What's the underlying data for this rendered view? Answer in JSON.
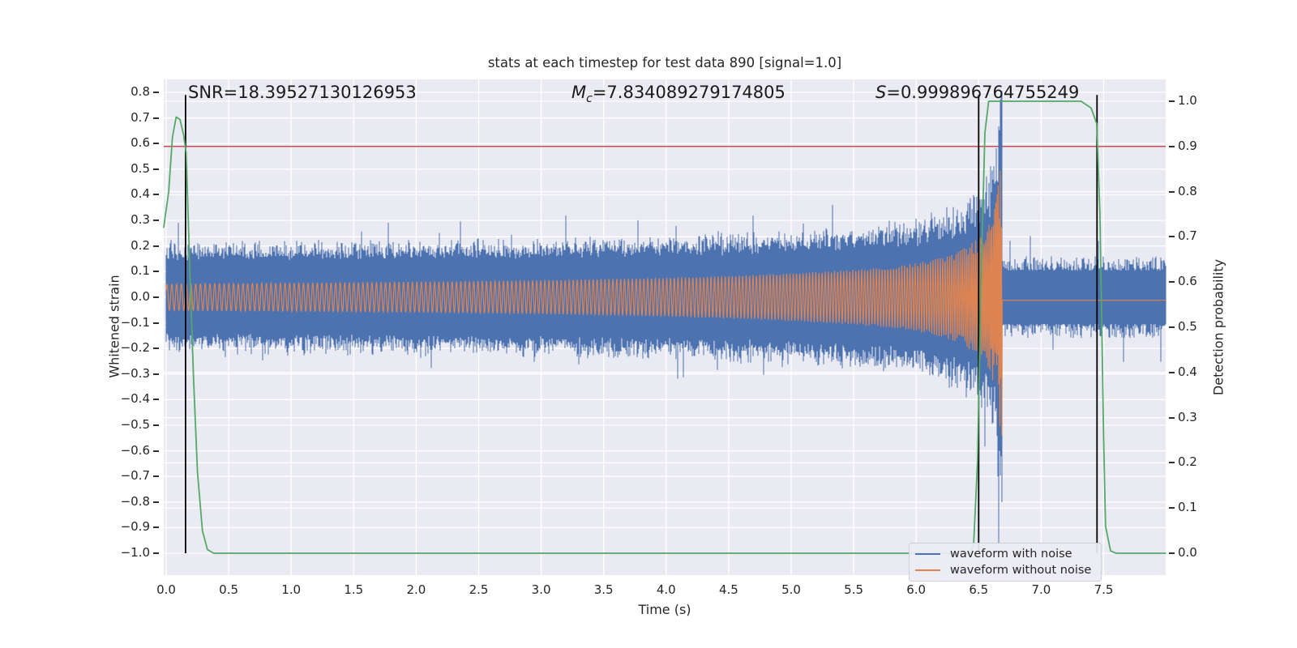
{
  "figure": {
    "kind": "matplotlib-seaborn-darkgrid",
    "background": "#ffffff"
  },
  "chart_data": {
    "type": "line",
    "title": "stats at each timestep for test data 890 [signal=1.0]",
    "xlabel": "Time (s)",
    "ylabel_left": "Whitened strain",
    "ylabel_right": "Detection probability",
    "xlim": [
      -0.02,
      8.0
    ],
    "ylim_left": [
      -1.09,
      0.85
    ],
    "ylim_right": [
      -0.047,
      1.048
    ],
    "grid": true,
    "xticks": {
      "values": [
        0,
        0.5,
        1,
        1.5,
        2,
        2.5,
        3,
        3.5,
        4,
        4.5,
        5,
        5.5,
        6,
        6.5,
        7,
        7.5
      ],
      "labels": [
        "0.0",
        "0.5",
        "1.0",
        "1.5",
        "2.0",
        "2.5",
        "3.0",
        "3.5",
        "4.0",
        "4.5",
        "5.0",
        "5.5",
        "6.0",
        "6.5",
        "7.0",
        "7.5"
      ]
    },
    "yticks_left": {
      "values": [
        0.8,
        0.7,
        0.6,
        0.5,
        0.4,
        0.3,
        0.2,
        0.1,
        0.0,
        -0.1,
        -0.2,
        -0.3,
        -0.4,
        -0.5,
        -0.6,
        -0.7,
        -0.8,
        -0.9,
        -1.0
      ],
      "labels": [
        "0.8",
        "0.7",
        "0.6",
        "0.5",
        "0.4",
        "0.3",
        "0.2",
        "0.1",
        "0.0",
        "−0.1",
        "−0.2",
        "−0.3",
        "−0.4",
        "−0.5",
        "−0.6",
        "−0.7",
        "−0.8",
        "−0.9",
        "−1.0"
      ]
    },
    "yticks_right": {
      "values": [
        1.0,
        0.9,
        0.8,
        0.7,
        0.6,
        0.5,
        0.4,
        0.3,
        0.2,
        0.1,
        0.0
      ],
      "labels": [
        "1.0",
        "0.9",
        "0.8",
        "0.7",
        "0.6",
        "0.5",
        "0.4",
        "0.3",
        "0.2",
        "0.1",
        "0.0"
      ]
    },
    "annotations": {
      "snr": "SNR=18.39527130126953",
      "chirp_mass": {
        "symbol": "M",
        "subscript": "c",
        "value": "=7.834089279174805"
      },
      "s": {
        "symbol": "S",
        "value": "=0.999896764755249"
      }
    },
    "threshold_line": {
      "axis": "right",
      "value": 0.9,
      "color": "#c44e52"
    },
    "vlines": {
      "times": [
        0.155,
        6.5,
        7.447
      ],
      "color": "#000000",
      "strain_span": [
        -1.0,
        0.79
      ]
    },
    "detection_probability": {
      "name": "detection probability",
      "color": "#55a868",
      "points_t_p": [
        [
          -0.02,
          0.72
        ],
        [
          0.02,
          0.8
        ],
        [
          0.05,
          0.92
        ],
        [
          0.08,
          0.965
        ],
        [
          0.11,
          0.96
        ],
        [
          0.14,
          0.925
        ],
        [
          0.16,
          0.885
        ],
        [
          0.19,
          0.62
        ],
        [
          0.22,
          0.38
        ],
        [
          0.25,
          0.18
        ],
        [
          0.29,
          0.05
        ],
        [
          0.33,
          0.008
        ],
        [
          0.38,
          0.0
        ],
        [
          6.43,
          0.0
        ],
        [
          6.46,
          0.02
        ],
        [
          6.49,
          0.2
        ],
        [
          6.52,
          0.62
        ],
        [
          6.55,
          0.93
        ],
        [
          6.58,
          1.0
        ],
        [
          7.32,
          1.0
        ],
        [
          7.4,
          0.985
        ],
        [
          7.445,
          0.95
        ],
        [
          7.47,
          0.75
        ],
        [
          7.5,
          0.25
        ],
        [
          7.515,
          0.06
        ],
        [
          7.555,
          0.005
        ],
        [
          7.6,
          0.0
        ],
        [
          8.0,
          0.0
        ]
      ]
    },
    "waveform_with_noise": {
      "name": "waveform with noise",
      "color": "#4c72b0",
      "noise_core_halfwidth": 0.125,
      "noise_spike_max": 0.27,
      "merger_spike": {
        "time": 6.665,
        "peak": 0.79,
        "trough": -0.96
      },
      "seed": 890
    },
    "waveform_without_noise": {
      "name": "waveform without noise",
      "color": "#dd8452",
      "merger_time": 6.688,
      "post_merger_level": -0.012,
      "envelope_t_amp": [
        [
          0,
          0.052
        ],
        [
          1,
          0.056
        ],
        [
          2,
          0.06
        ],
        [
          3,
          0.066
        ],
        [
          4,
          0.076
        ],
        [
          4.5,
          0.083
        ],
        [
          5,
          0.093
        ],
        [
          5.5,
          0.107
        ],
        [
          5.8,
          0.118
        ],
        [
          6.0,
          0.133
        ],
        [
          6.2,
          0.155
        ],
        [
          6.35,
          0.18
        ],
        [
          6.5,
          0.23
        ],
        [
          6.58,
          0.28
        ],
        [
          6.63,
          0.35
        ],
        [
          6.66,
          0.45
        ],
        [
          6.675,
          0.55
        ],
        [
          6.683,
          0.68
        ],
        [
          6.688,
          0.76
        ]
      ],
      "frequency_t_hz": [
        [
          0,
          26
        ],
        [
          2,
          28
        ],
        [
          4,
          33
        ],
        [
          5,
          38
        ],
        [
          5.8,
          44
        ],
        [
          6.2,
          52
        ],
        [
          6.5,
          70
        ],
        [
          6.6,
          85
        ],
        [
          6.65,
          105
        ],
        [
          6.688,
          135
        ]
      ]
    },
    "legend": {
      "position": "lower right",
      "entries": [
        {
          "label": "waveform with noise",
          "color": "#4c72b0"
        },
        {
          "label": "waveform without noise",
          "color": "#dd8452"
        }
      ]
    },
    "colors": {
      "plot_background": "#eaeaf2",
      "grid": "#ffffff",
      "text": "#262626"
    }
  }
}
